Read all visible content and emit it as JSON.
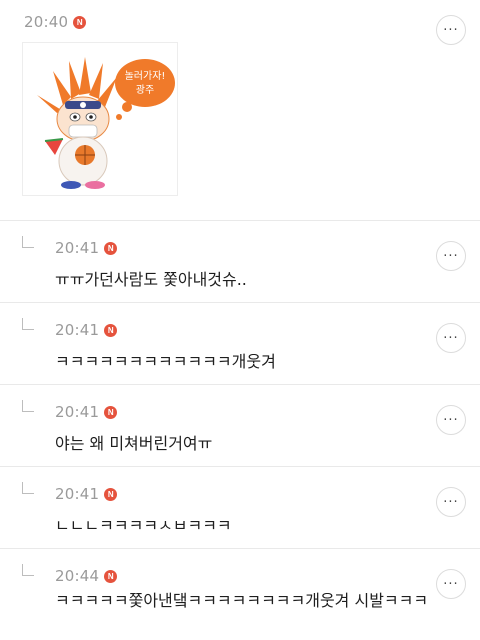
{
  "top_comment": {
    "time": "20:40",
    "badge": "N",
    "more": "···",
    "sticker_bubble_text": "놀러가자!\n광주"
  },
  "replies": [
    {
      "time": "20:41",
      "badge": "N",
      "more": "···",
      "text": "ㅠㅠ가던사람도 쫓아내것슈.."
    },
    {
      "time": "20:41",
      "badge": "N",
      "more": "···",
      "text": "ㅋㅋㅋㅋㅋㅋㅋㅋㅋㅋㅋㅋ개웃겨"
    },
    {
      "time": "20:41",
      "badge": "N",
      "more": "···",
      "text": "야는 왜 미쳐버린거여ㅠ"
    },
    {
      "time": "20:41",
      "badge": "N",
      "more": "···",
      "text": "ㄴㄴㄴㅋㅋㅋㅋㅅㅂㅋㅋㅋ"
    },
    {
      "time": "20:44",
      "badge": "N",
      "more": "···",
      "text": "ㅋㅋㅋㅋㅋ쫓아낸댘ㅋㅋㅋㅋㅋㅋㅋㅋ개웃겨 시발ㅋㅋㅋ"
    }
  ],
  "colors": {
    "badge": "#e5533d",
    "time": "#9a9a9a",
    "divider": "#e9e9e9",
    "sticker_orange": "#f07a2a"
  }
}
